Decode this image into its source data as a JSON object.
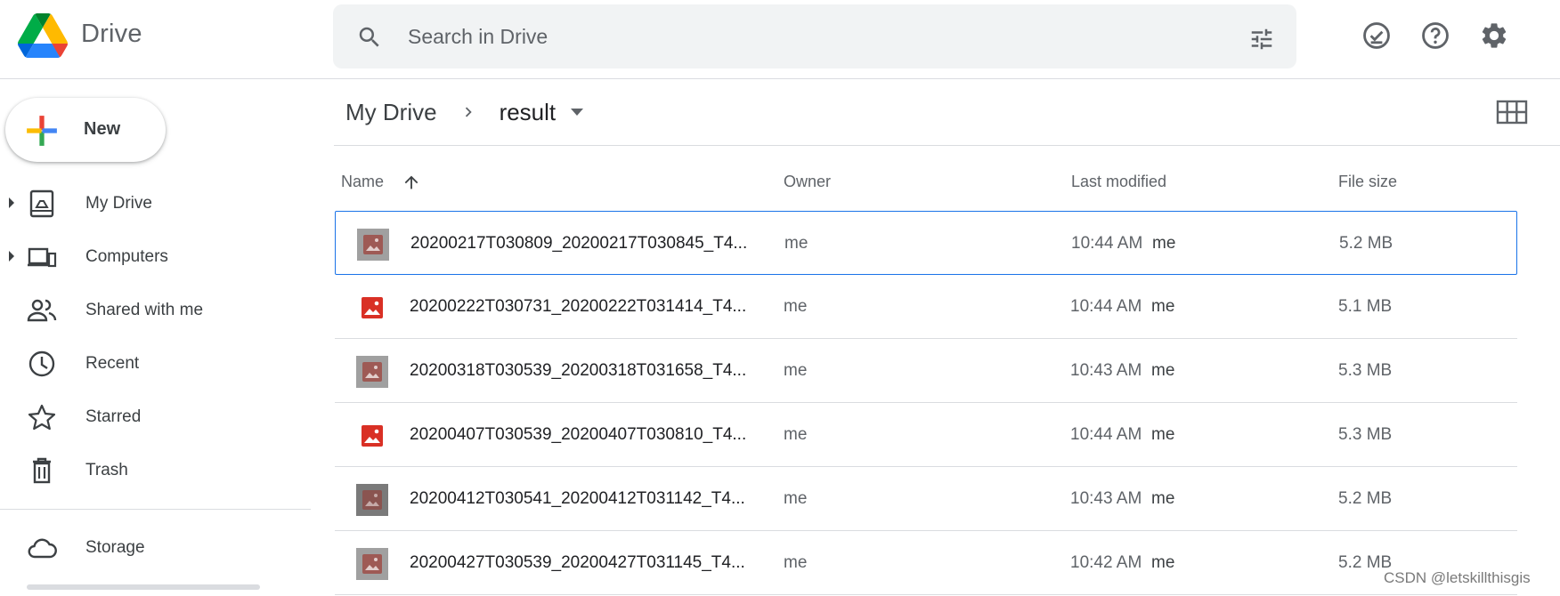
{
  "app": {
    "brand": "Drive"
  },
  "search": {
    "placeholder": "Search in Drive"
  },
  "sidebar": {
    "new_label": "New",
    "items": [
      {
        "label": "My Drive"
      },
      {
        "label": "Computers"
      },
      {
        "label": "Shared with me"
      },
      {
        "label": "Recent"
      },
      {
        "label": "Starred"
      },
      {
        "label": "Trash"
      },
      {
        "label": "Storage"
      }
    ]
  },
  "breadcrumb": {
    "root": "My Drive",
    "current": "result"
  },
  "table": {
    "headers": {
      "name": "Name",
      "owner": "Owner",
      "modified": "Last modified",
      "size": "File size"
    },
    "rows": [
      {
        "name": "20200217T030809_20200217T030845_T4...",
        "owner": "me",
        "modified": "10:44 AM",
        "modified_by": "me",
        "size": "5.2 MB",
        "selected": true
      },
      {
        "name": "20200222T030731_20200222T031414_T4...",
        "owner": "me",
        "modified": "10:44 AM",
        "modified_by": "me",
        "size": "5.1 MB"
      },
      {
        "name": "20200318T030539_20200318T031658_T4...",
        "owner": "me",
        "modified": "10:43 AM",
        "modified_by": "me",
        "size": "5.3 MB"
      },
      {
        "name": "20200407T030539_20200407T030810_T4...",
        "owner": "me",
        "modified": "10:44 AM",
        "modified_by": "me",
        "size": "5.3 MB"
      },
      {
        "name": "20200412T030541_20200412T031142_T4...",
        "owner": "me",
        "modified": "10:43 AM",
        "modified_by": "me",
        "size": "5.2 MB"
      },
      {
        "name": "20200427T030539_20200427T031145_T4...",
        "owner": "me",
        "modified": "10:42 AM",
        "modified_by": "me",
        "size": "5.2 MB"
      }
    ]
  },
  "watermark": "CSDN @letskillthisgis",
  "colors": {
    "accent": "#1a73e8",
    "divider": "#dadce0",
    "search_bg": "#f1f3f4",
    "image_icon_red": "#d93025"
  }
}
